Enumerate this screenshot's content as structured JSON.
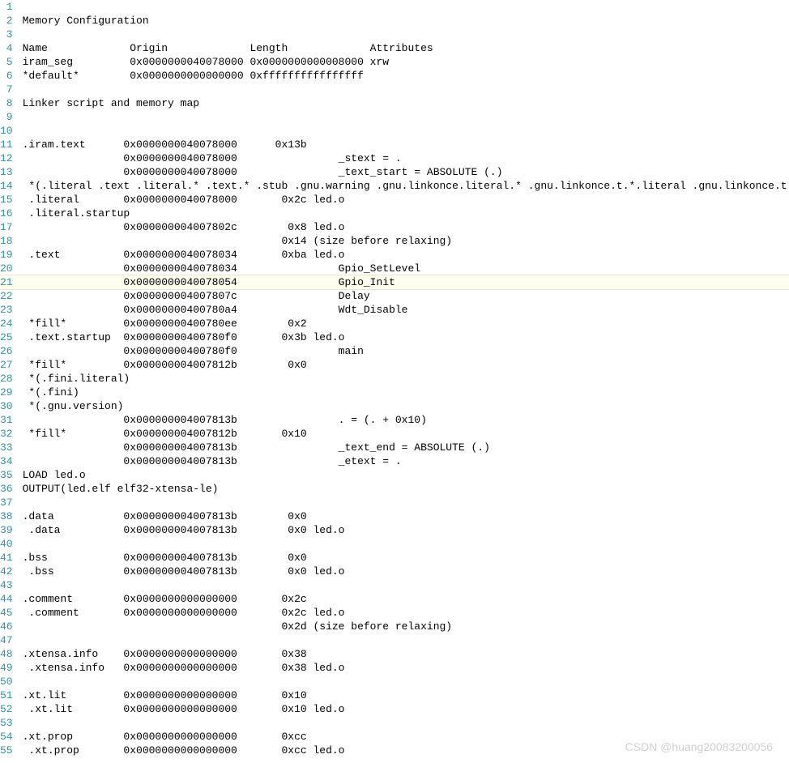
{
  "gutter_color": "#2b91af",
  "text_color": "#000000",
  "highlight_bg": "#fefef0",
  "watermark": "CSDN @huang20083200056",
  "highlighted_line_index": 20,
  "lines": [
    "",
    "Memory Configuration",
    "",
    "Name             Origin             Length             Attributes",
    "iram_seg         0x0000000040078000 0x0000000000008000 xrw",
    "*default*        0x0000000000000000 0xffffffffffffffff",
    "",
    "Linker script and memory map",
    "",
    "",
    ".iram.text      0x0000000040078000      0x13b",
    "                0x0000000040078000                _stext = .",
    "                0x0000000040078000                _text_start = ABSOLUTE (.)",
    " *(.literal .text .literal.* .text.* .stub .gnu.warning .gnu.linkonce.literal.* .gnu.linkonce.t.*.literal .gnu.linkonce.t.*)",
    " .literal       0x0000000040078000       0x2c led.o",
    " .literal.startup",
    "                0x000000004007802c        0x8 led.o",
    "                                         0x14 (size before relaxing)",
    " .text          0x0000000040078034       0xba led.o",
    "                0x0000000040078034                Gpio_SetLevel",
    "                0x0000000040078054                Gpio_Init",
    "                0x000000004007807c                Delay",
    "                0x00000000400780a4                Wdt_Disable",
    " *fill*         0x00000000400780ee        0x2",
    " .text.startup  0x00000000400780f0       0x3b led.o",
    "                0x00000000400780f0                main",
    " *fill*         0x000000004007812b        0x0",
    " *(.fini.literal)",
    " *(.fini)",
    " *(.gnu.version)",
    "                0x000000004007813b                . = (. + 0x10)",
    " *fill*         0x000000004007812b       0x10",
    "                0x000000004007813b                _text_end = ABSOLUTE (.)",
    "                0x000000004007813b                _etext = .",
    "LOAD led.o",
    "OUTPUT(led.elf elf32-xtensa-le)",
    "",
    ".data           0x000000004007813b        0x0",
    " .data          0x000000004007813b        0x0 led.o",
    "",
    ".bss            0x000000004007813b        0x0",
    " .bss           0x000000004007813b        0x0 led.o",
    "",
    ".comment        0x0000000000000000       0x2c",
    " .comment       0x0000000000000000       0x2c led.o",
    "                                         0x2d (size before relaxing)",
    "",
    ".xtensa.info    0x0000000000000000       0x38",
    " .xtensa.info   0x0000000000000000       0x38 led.o",
    "",
    ".xt.lit         0x0000000000000000       0x10",
    " .xt.lit        0x0000000000000000       0x10 led.o",
    "",
    ".xt.prop        0x0000000000000000       0xcc",
    " .xt.prop       0x0000000000000000       0xcc led.o"
  ]
}
